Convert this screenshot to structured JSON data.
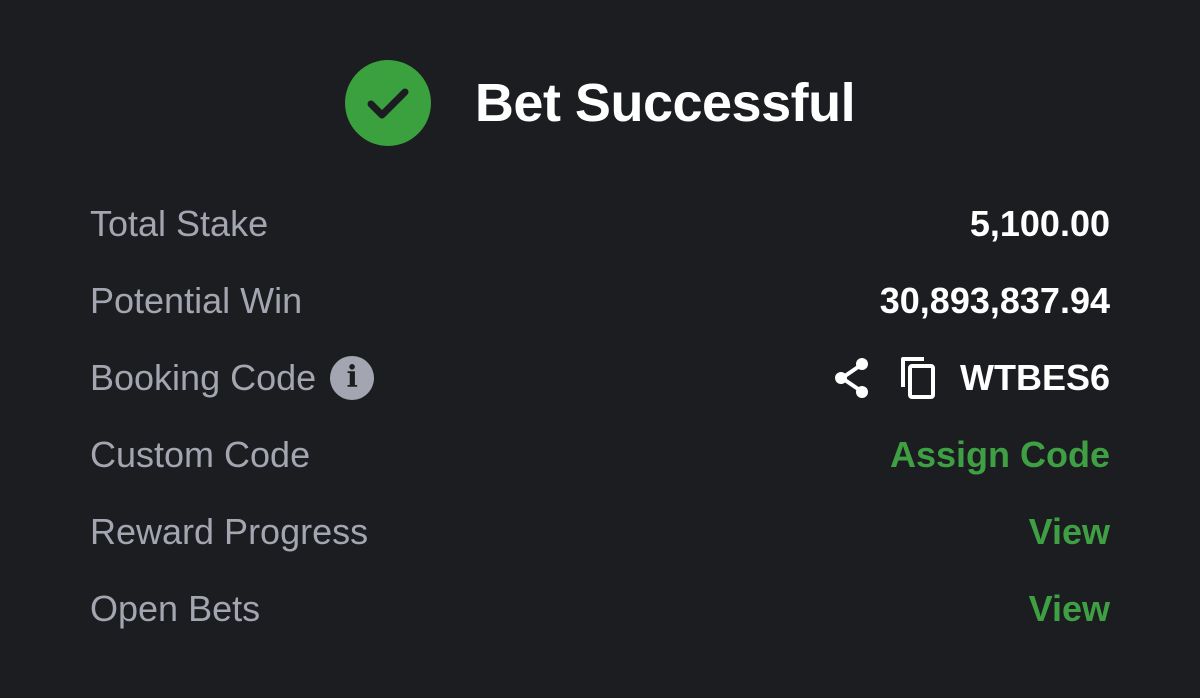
{
  "header": {
    "title": "Bet Successful",
    "status_icon": "check-circle-icon",
    "status_color": "#3aa13e"
  },
  "rows": {
    "total_stake": {
      "label": "Total Stake",
      "value": "5,100.00"
    },
    "potential_win": {
      "label": "Potential Win",
      "value": "30,893,837.94"
    },
    "booking_code": {
      "label": "Booking Code",
      "info_icon": "info-icon",
      "info_glyph": "i",
      "share_icon": "share-icon",
      "copy_icon": "copy-icon",
      "value": "WTBES6"
    },
    "custom_code": {
      "label": "Custom Code",
      "action": "Assign Code"
    },
    "reward_progress": {
      "label": "Reward Progress",
      "action": "View"
    },
    "open_bets": {
      "label": "Open Bets",
      "action": "View"
    }
  },
  "colors": {
    "background": "#1c1d21",
    "label": "#a3a6b0",
    "value": "#ffffff",
    "accent_green": "#3fa043"
  }
}
